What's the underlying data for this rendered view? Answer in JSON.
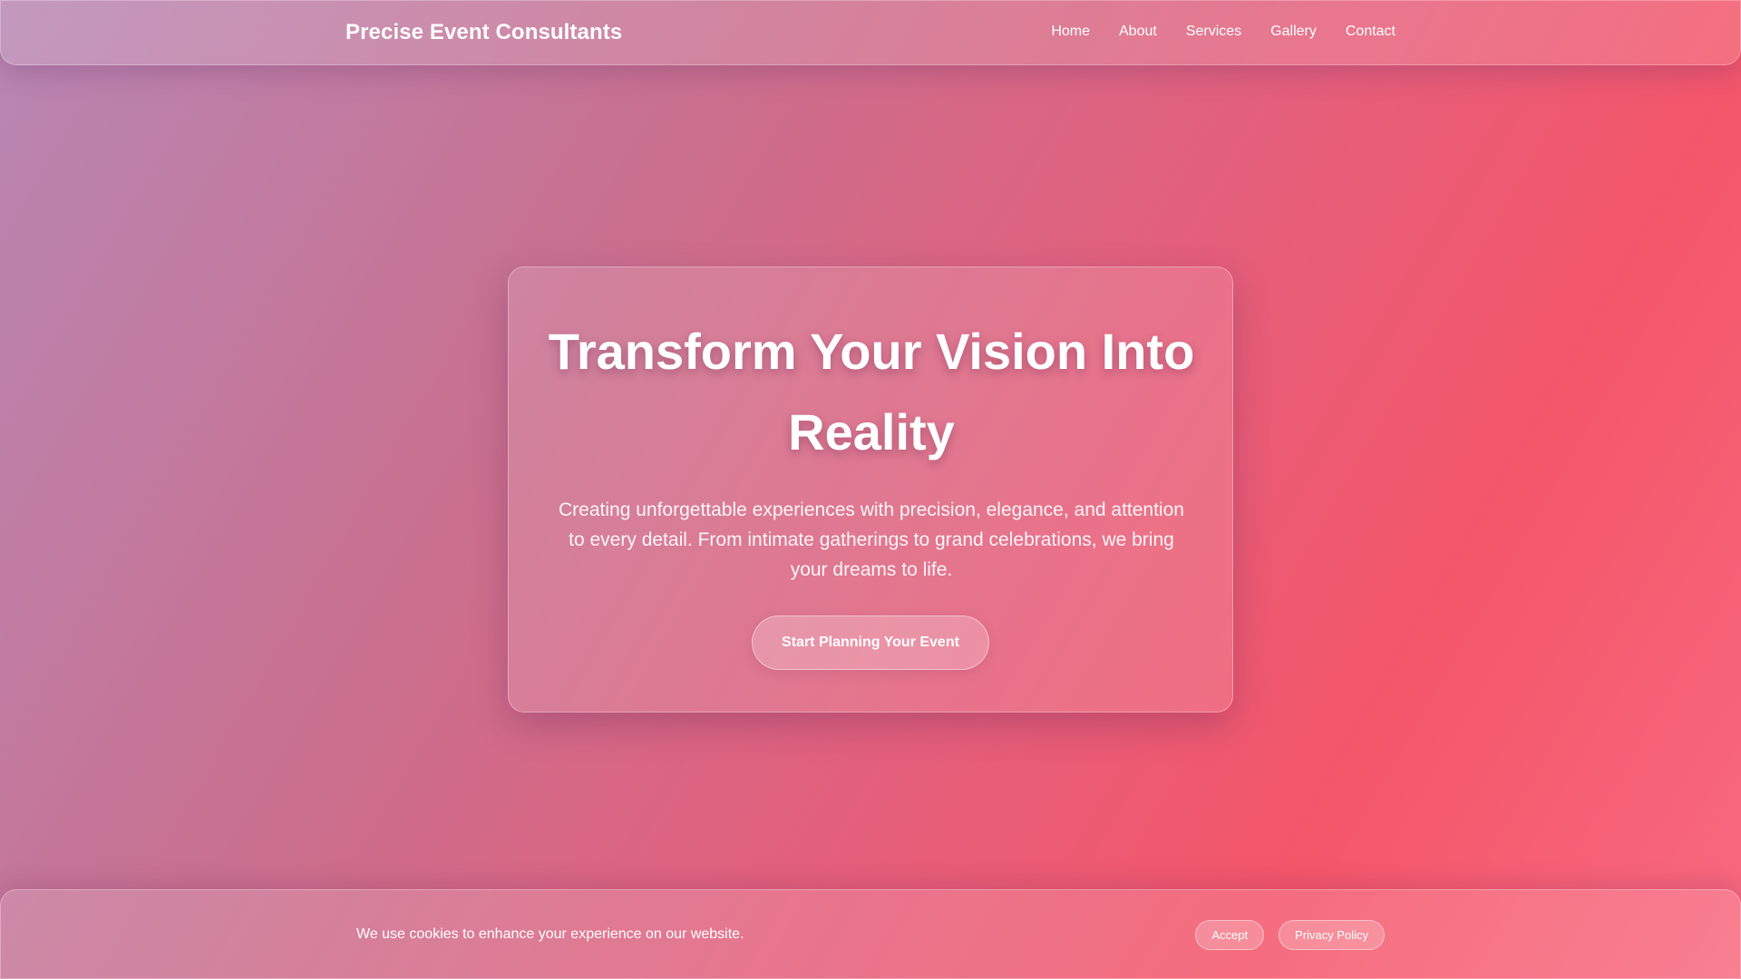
{
  "header": {
    "brand": "Precise Event Consultants",
    "nav": [
      {
        "label": "Home"
      },
      {
        "label": "About"
      },
      {
        "label": "Services"
      },
      {
        "label": "Gallery"
      },
      {
        "label": "Contact"
      }
    ]
  },
  "hero": {
    "title": "Transform Your Vision Into Reality",
    "description": "Creating unforgettable experiences with precision, elegance, and attention to every detail. From intimate gatherings to grand celebrations, we bring your dreams to life.",
    "cta_label": "Start Planning Your Event"
  },
  "cookie_banner": {
    "message": "We use cookies to enhance your experience on our website.",
    "accept_label": "Accept",
    "privacy_label": "Privacy Policy"
  },
  "colors": {
    "background_start": "#b887b4",
    "background_mid": "#e45f7b",
    "background_end": "#f86a80",
    "text": "#ffffff"
  }
}
